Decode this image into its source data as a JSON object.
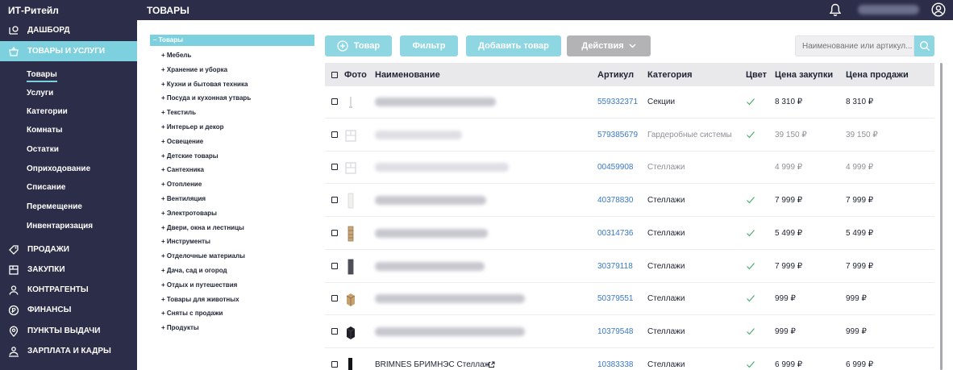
{
  "app": {
    "title": "ИТ-Ритейл",
    "page_title": "ТОВАРЫ",
    "user_name": "Фамилия Имя"
  },
  "sidebar": {
    "items": [
      {
        "label": "ДАШБОРД",
        "icon": "chart-icon"
      },
      {
        "label": "ТОВАРЫ И УСЛУГИ",
        "icon": "basket-icon",
        "active": true
      },
      {
        "label": "ПРОДАЖИ",
        "icon": "tag-icon"
      },
      {
        "label": "ЗАКУПКИ",
        "icon": "box-icon"
      },
      {
        "label": "КОНТРАГЕНТЫ",
        "icon": "person-icon"
      },
      {
        "label": "ФИНАНСЫ",
        "icon": "coin-icon"
      },
      {
        "label": "ПУНКТЫ ВЫДАЧИ",
        "icon": "location-icon"
      },
      {
        "label": "ЗАРПЛАТА И КАДРЫ",
        "icon": "team-icon"
      }
    ],
    "subitems": [
      "Товары",
      "Услуги",
      "Категории",
      "Комнаты",
      "Остатки",
      "Оприходование",
      "Списание",
      "Перемещение",
      "Инвентаризация"
    ]
  },
  "tree": {
    "root": "– Товары",
    "items": [
      "+ Мебель",
      "+ Хранение и уборка",
      "+ Кухни и бытовая техника",
      "+ Посуда и кухонная утварь",
      "+ Текстиль",
      "+ Интерьер и декор",
      "+ Освещение",
      "+ Детские товары",
      "+ Сантехника",
      "+ Отопление",
      "+ Вентиляция",
      "+ Электротовары",
      "+ Двери, окна и лестницы",
      "+ Инструменты",
      "+ Отделочные материалы",
      "+ Дача, сад и огород",
      "+ Отдых и путешествия",
      "+ Товары для животных",
      "+ Сняты с продажи",
      "+ Продукты"
    ]
  },
  "toolbar": {
    "add_product": "Товар",
    "filter": "Фильтр",
    "add_good": "Добавить товар",
    "actions": "Действия",
    "search_placeholder": "Наименование или артикул..."
  },
  "table": {
    "headers": {
      "photo": "Фото",
      "name": "Наименование",
      "sku": "Артикул",
      "category": "Категория",
      "color": "Цвет",
      "buy_price": "Цена закупки",
      "sell_price": "Цена продажи"
    },
    "rows": [
      {
        "name": "",
        "sku": "559332371",
        "category": "Секции",
        "color": true,
        "buy": "8 310 ₽",
        "sell": "8 310 ₽",
        "faded": false
      },
      {
        "name": "",
        "sku": "579385679",
        "category": "Гардеробные системы",
        "color": true,
        "buy": "39 150 ₽",
        "sell": "39 150 ₽",
        "faded": true
      },
      {
        "name": "",
        "sku": "00459908",
        "category": "Стеллажи",
        "color": false,
        "buy": "4 999 ₽",
        "sell": "4 999 ₽",
        "faded": true
      },
      {
        "name": "",
        "sku": "40378830",
        "category": "Стеллажи",
        "color": true,
        "buy": "7 999 ₽",
        "sell": "7 999 ₽",
        "faded": false
      },
      {
        "name": "",
        "sku": "00314736",
        "category": "Стеллажи",
        "color": true,
        "buy": "5 499 ₽",
        "sell": "5 499 ₽",
        "faded": false
      },
      {
        "name": "",
        "sku": "30379118",
        "category": "Стеллажи",
        "color": true,
        "buy": "7 999 ₽",
        "sell": "7 999 ₽",
        "faded": false
      },
      {
        "name": "",
        "sku": "50379551",
        "category": "Стеллажи",
        "color": true,
        "buy": "999 ₽",
        "sell": "999 ₽",
        "faded": false
      },
      {
        "name": "",
        "sku": "10379548",
        "category": "Стеллажи",
        "color": true,
        "buy": "999 ₽",
        "sell": "999 ₽",
        "faded": false
      },
      {
        "name": "BRIMNES БРИМНЭС Стеллаж",
        "sku": "10383338",
        "category": "Стеллажи",
        "color": true,
        "buy": "6 999 ₽",
        "sell": "6 999 ₽",
        "faded": false
      }
    ]
  },
  "colors": {
    "sidebar": "#2b2d49",
    "accent": "#7dd0de",
    "link": "#3978c8",
    "check": "#4caf6a"
  }
}
